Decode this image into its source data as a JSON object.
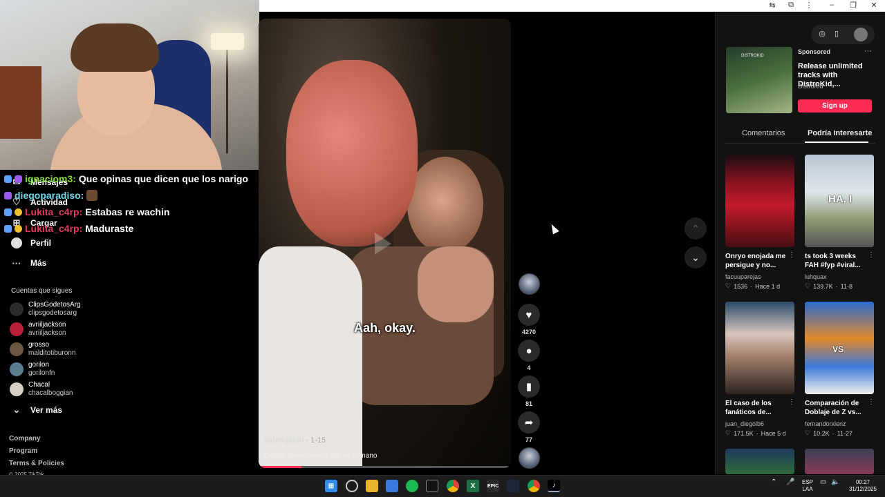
{
  "chat": [
    {
      "user": "ignaciom3:",
      "message": "Que opinas que dicen que los narigo",
      "user_color": "#7cdf36"
    },
    {
      "user": "diegoparadiso:",
      "message": "",
      "user_color": "#6fd8e8"
    },
    {
      "user": "Lukita_c4rp:",
      "message": "Estabas re wachin",
      "user_color": "#e63a5c"
    },
    {
      "user": "Lukita_c4rp:",
      "message": "Maduraste",
      "user_color": "#e63a5c"
    }
  ],
  "nav": {
    "items": [
      {
        "label": "Mensajes",
        "icon": "message-icon"
      },
      {
        "label": "Actividad",
        "icon": "activity-icon"
      },
      {
        "label": "Cargar",
        "icon": "upload-icon"
      },
      {
        "label": "Perfil",
        "icon": "profile-icon"
      },
      {
        "label": "Más",
        "icon": "more-icon"
      }
    ],
    "following_title": "Cuentas que sigues",
    "following": [
      {
        "name": "ClipsGodetosArg",
        "handle": "clipsgodetosarg",
        "color": "#2b2b2b"
      },
      {
        "name": "avriiljackson",
        "handle": "avriiljackson",
        "color": "#b8203a"
      },
      {
        "name": "grosso",
        "handle": "malditotiburonn",
        "color": "#6a5844"
      },
      {
        "name": "gorilon",
        "handle": "gorilonfn",
        "color": "#5c7f90"
      },
      {
        "name": "Chacal",
        "handle": "chacalboggian",
        "color": "#d7cfc5"
      }
    ],
    "see_more": "Ver más",
    "footer": [
      "Company",
      "Program",
      "Terms & Policies",
      "© 2025 TikTok"
    ]
  },
  "video": {
    "caption": "Aah, okay.",
    "author": "valenganin",
    "date": "· 1-15",
    "description": "Colidio demostrando que es humano",
    "progress": 0.17
  },
  "actions": {
    "likes": "4270",
    "comments": "4",
    "saves": "81",
    "shares": "77"
  },
  "ad": {
    "sponsored": "Sponsored",
    "title": "Release unlimited tracks with DistroKid,...",
    "brand": "DistroKid",
    "button": "Sign up",
    "thumb_text": "DISTROKID"
  },
  "tabs": [
    "Comentarios",
    "Podría interesarte"
  ],
  "cards": [
    {
      "title": "Onryo enojada me persigue y no...",
      "author": "facuuparejas",
      "likes": "1536",
      "date": "Hace 1 d",
      "thumb_text": ""
    },
    {
      "title": "ts took 3 weeks FAH #fyp #viral...",
      "author": "luhquax",
      "likes": "139.7K",
      "date": "11-8",
      "thumb_text": "HA, I"
    },
    {
      "title": "El caso de los fanáticos de...",
      "author": "juan_diegolb6",
      "likes": "171.5K",
      "date": "Hace 5 d",
      "thumb_text": ""
    },
    {
      "title": "Comparación de Doblaje de Z vs...",
      "author": "fernandorxlenz",
      "likes": "10.2K",
      "date": "11-27",
      "thumb_text": "VS"
    }
  ],
  "taskbar": {
    "lang": "ESP",
    "lang2": "LAA",
    "time": "00:27",
    "date": "31/12/2025",
    "app_labels": {
      "epic": "EPIC"
    }
  },
  "colors": {
    "accent": "#fe2c55"
  }
}
